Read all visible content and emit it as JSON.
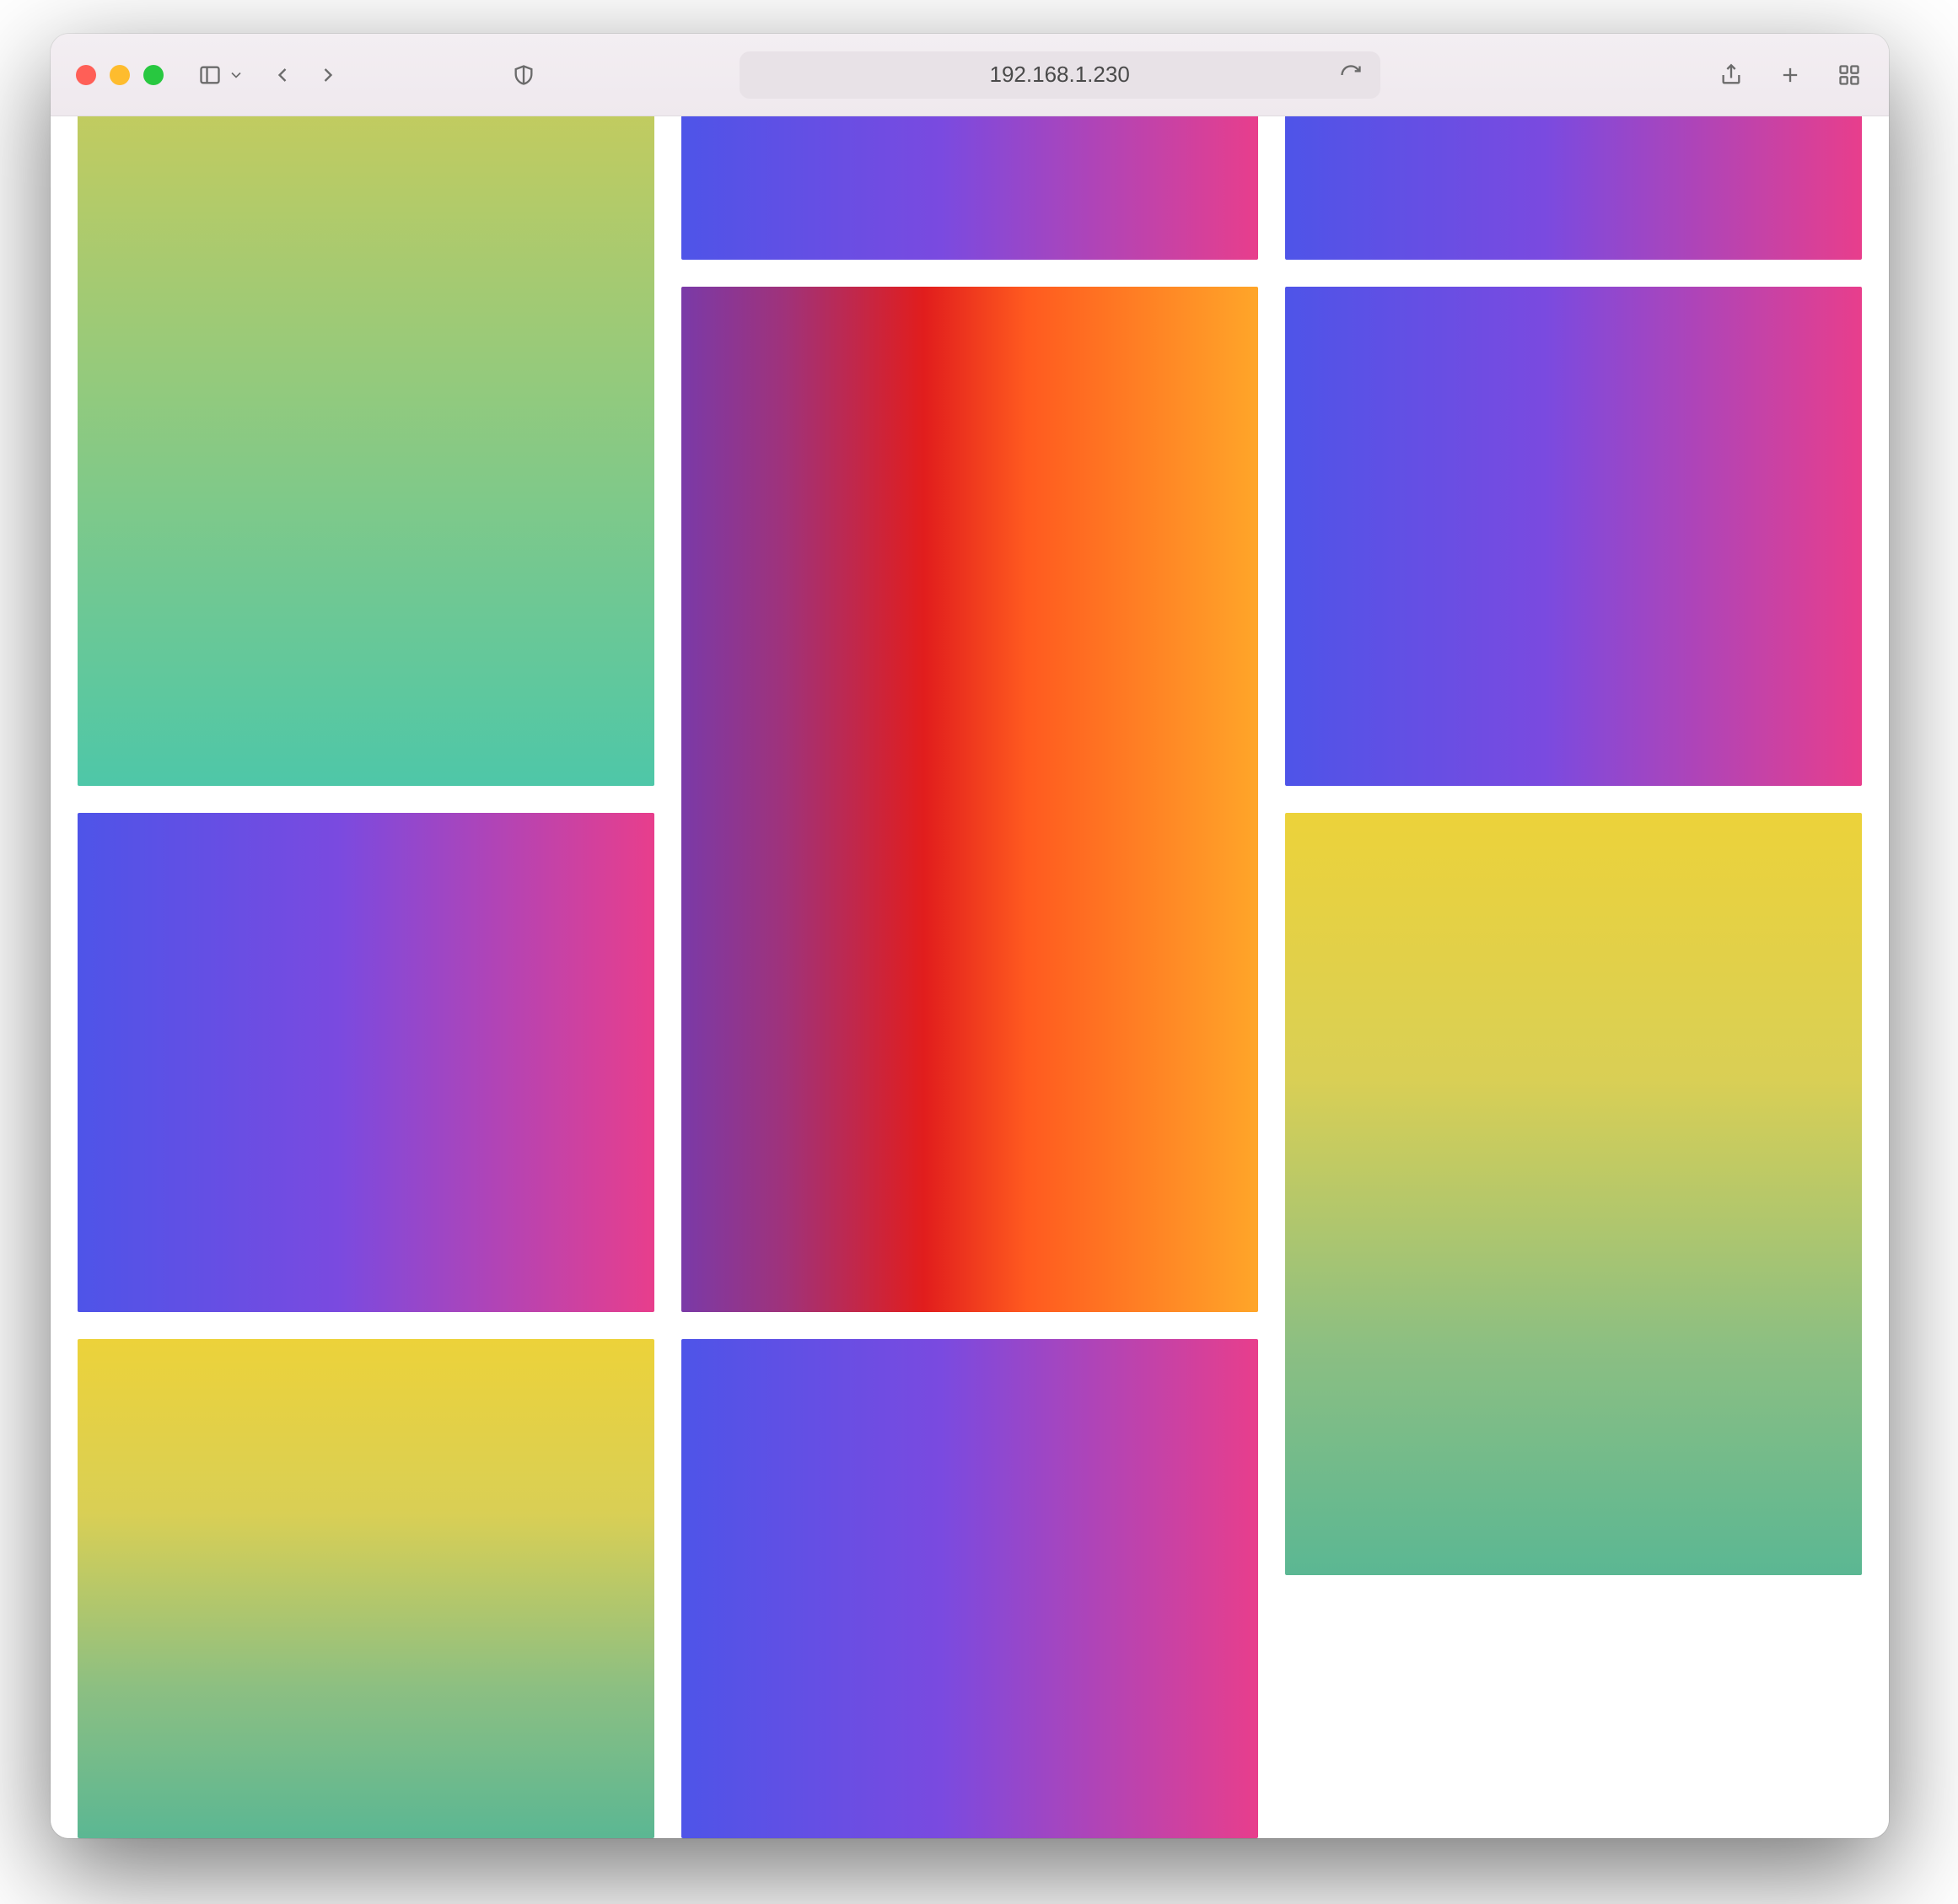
{
  "browser": {
    "address": "192.168.1.230"
  },
  "tiles": [
    {
      "id": "t1",
      "gradient": "olive-teal"
    },
    {
      "id": "t2",
      "gradient": "blue-pink"
    },
    {
      "id": "t3",
      "gradient": "blue-pink"
    },
    {
      "id": "t4",
      "gradient": "rainbow"
    },
    {
      "id": "t5",
      "gradient": "blue-pink"
    },
    {
      "id": "t6",
      "gradient": "blue-pink"
    },
    {
      "id": "t7",
      "gradient": "gold-green"
    },
    {
      "id": "t8",
      "gradient": "gold-green"
    },
    {
      "id": "t9",
      "gradient": "blue-pink"
    }
  ]
}
